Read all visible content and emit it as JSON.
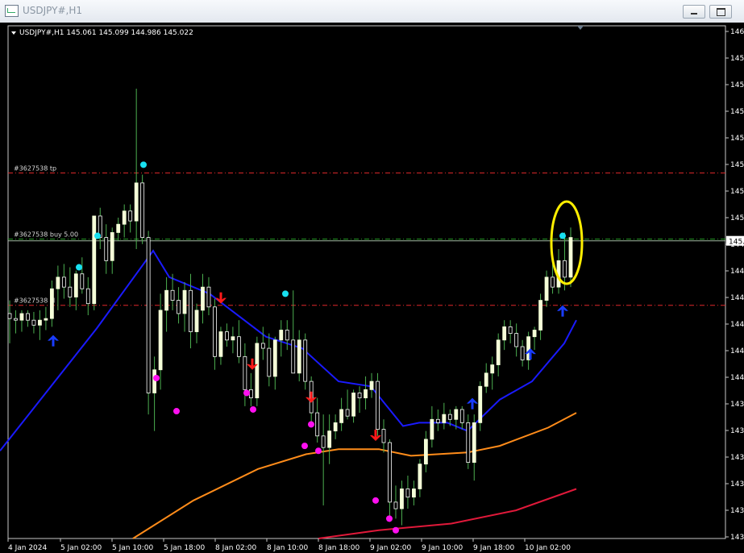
{
  "window": {
    "title": "USDJPY#,H1"
  },
  "chart_header": "USDJPY#,H1  145.061 145.099 144.986 145.022",
  "order_lines": [
    {
      "label": "#3627538 tp",
      "price": 145.41,
      "style": "dash-dot",
      "color": "#e0292b"
    },
    {
      "label": "#3627538 buy 5.00",
      "price": 145.01,
      "style": "dash-dot",
      "color": "#2a9d2a"
    },
    {
      "label": "#3627538 sl",
      "price": 144.61,
      "style": "dash-dot",
      "color": "#e0292b"
    }
  ],
  "bid_price_label": "145.0",
  "price_axis_labels": [
    "146.",
    "145.",
    "145.",
    "145.",
    "145.",
    "145.",
    "145.",
    "145.",
    "144.",
    "144.",
    "144.",
    "144.",
    "144.",
    "144.",
    "143.",
    "143.",
    "143.",
    "143.",
    "143.",
    "143."
  ],
  "time_axis_labels": [
    "4 Jan 2024",
    "5 Jan 02:00",
    "5 Jan 10:00",
    "5 Jan 18:00",
    "8 Jan 02:00",
    "8 Jan 10:00",
    "8 Jan 18:00",
    "9 Jan 02:00",
    "9 Jan 10:00",
    "9 Jan 18:00",
    "10 Jan 02:00"
  ],
  "colors": {
    "bg": "#000000",
    "candle_up": "#f5ffd8",
    "candle_down": "#ffffff",
    "wick": "#4caf50",
    "ma_fast": "#1a1aff",
    "ma_mid": "#ff8c1a",
    "ma_slow": "#e0193a",
    "dot_cyan": "#18e0f0",
    "dot_magenta": "#ff10f0",
    "arrow_up": "#1a3cff",
    "arrow_down": "#ff1a1a",
    "highlight": "#ffee00"
  },
  "chart_data": {
    "type": "candlestick",
    "symbol": "USDJPY#",
    "timeframe": "H1",
    "ylim": [
      143.2,
      146.3
    ],
    "candles": [
      [
        144.56,
        144.64,
        144.38,
        144.53
      ],
      [
        144.53,
        144.58,
        144.44,
        144.52
      ],
      [
        144.52,
        144.58,
        144.45,
        144.56
      ],
      [
        144.56,
        144.58,
        144.48,
        144.52
      ],
      [
        144.52,
        144.57,
        144.44,
        144.49
      ],
      [
        144.49,
        144.58,
        144.4,
        144.52
      ],
      [
        144.52,
        144.6,
        144.46,
        144.53
      ],
      [
        144.53,
        144.76,
        144.48,
        144.71
      ],
      [
        144.71,
        144.85,
        144.58,
        144.78
      ],
      [
        144.78,
        144.86,
        144.65,
        144.72
      ],
      [
        144.72,
        144.84,
        144.6,
        144.66
      ],
      [
        144.66,
        144.82,
        144.58,
        144.8
      ],
      [
        144.8,
        144.9,
        144.68,
        144.71
      ],
      [
        144.71,
        144.78,
        144.55,
        144.62
      ],
      [
        144.62,
        145.1,
        144.58,
        145.15
      ],
      [
        145.15,
        145.2,
        144.95,
        145.02
      ],
      [
        145.02,
        145.1,
        144.8,
        144.88
      ],
      [
        144.88,
        145.08,
        144.8,
        145.05
      ],
      [
        145.05,
        145.14,
        145.0,
        145.1
      ],
      [
        145.1,
        145.22,
        145.02,
        145.18
      ],
      [
        145.18,
        145.22,
        145.05,
        145.12
      ],
      [
        145.12,
        145.92,
        144.95,
        145.35
      ],
      [
        145.35,
        145.4,
        144.98,
        145.02
      ],
      [
        145.02,
        145.06,
        143.95,
        144.08
      ],
      [
        144.08,
        144.3,
        143.85,
        144.22
      ],
      [
        144.22,
        144.68,
        144.1,
        144.58
      ],
      [
        144.58,
        144.78,
        144.45,
        144.7
      ],
      [
        144.7,
        144.8,
        144.58,
        144.64
      ],
      [
        144.64,
        144.72,
        144.5,
        144.56
      ],
      [
        144.56,
        144.75,
        144.45,
        144.7
      ],
      [
        144.7,
        144.8,
        144.35,
        144.45
      ],
      [
        144.45,
        144.62,
        144.38,
        144.58
      ],
      [
        144.58,
        144.8,
        144.5,
        144.72
      ],
      [
        144.72,
        144.78,
        144.55,
        144.6
      ],
      [
        144.6,
        144.65,
        144.22,
        144.3
      ],
      [
        144.3,
        144.48,
        144.25,
        144.45
      ],
      [
        144.45,
        144.5,
        144.36,
        144.4
      ],
      [
        144.4,
        144.48,
        144.32,
        144.42
      ],
      [
        144.42,
        144.52,
        144.26,
        144.3
      ],
      [
        144.3,
        144.38,
        144.0,
        144.1
      ],
      [
        144.1,
        144.2,
        144.0,
        144.05
      ],
      [
        144.05,
        144.42,
        144.0,
        144.38
      ],
      [
        144.38,
        144.48,
        144.28,
        144.35
      ],
      [
        144.35,
        144.44,
        144.12,
        144.18
      ],
      [
        144.18,
        144.42,
        144.1,
        144.4
      ],
      [
        144.4,
        144.52,
        144.3,
        144.46
      ],
      [
        144.46,
        144.52,
        144.34,
        144.4
      ],
      [
        144.4,
        144.7,
        144.35,
        144.2
      ],
      [
        144.2,
        144.46,
        144.15,
        144.4
      ],
      [
        144.4,
        144.44,
        144.1,
        144.15
      ],
      [
        144.15,
        144.18,
        143.9,
        143.96
      ],
      [
        143.96,
        144.05,
        143.78,
        143.82
      ],
      [
        143.82,
        143.95,
        143.4,
        143.75
      ],
      [
        143.75,
        143.95,
        143.65,
        143.85
      ],
      [
        143.85,
        143.95,
        143.8,
        143.9
      ],
      [
        143.9,
        144.05,
        143.85,
        143.98
      ],
      [
        143.98,
        144.1,
        143.92,
        143.94
      ],
      [
        143.94,
        144.1,
        143.9,
        144.08
      ],
      [
        144.08,
        144.12,
        143.96,
        144.05
      ],
      [
        144.05,
        144.18,
        143.98,
        144.1
      ],
      [
        144.1,
        144.2,
        144.05,
        144.15
      ],
      [
        144.15,
        144.2,
        143.82,
        143.86
      ],
      [
        143.86,
        143.92,
        143.72,
        143.78
      ],
      [
        143.78,
        143.8,
        143.3,
        143.42
      ],
      [
        143.42,
        143.52,
        143.32,
        143.38
      ],
      [
        143.38,
        143.55,
        143.28,
        143.5
      ],
      [
        143.5,
        143.58,
        143.38,
        143.45
      ],
      [
        143.45,
        143.55,
        143.4,
        143.5
      ],
      [
        143.5,
        143.68,
        143.45,
        143.65
      ],
      [
        143.65,
        143.85,
        143.6,
        143.8
      ],
      [
        143.8,
        144.0,
        143.75,
        143.92
      ],
      [
        143.92,
        143.98,
        143.85,
        143.9
      ],
      [
        143.9,
        144.02,
        143.86,
        143.95
      ],
      [
        143.95,
        143.98,
        143.88,
        143.92
      ],
      [
        143.92,
        144.0,
        143.86,
        143.98
      ],
      [
        143.98,
        144.0,
        143.86,
        143.9
      ],
      [
        143.9,
        143.95,
        143.62,
        143.66
      ],
      [
        143.66,
        143.95,
        143.55,
        143.9
      ],
      [
        143.9,
        144.15,
        143.85,
        144.12
      ],
      [
        144.12,
        144.26,
        144.08,
        144.2
      ],
      [
        144.2,
        144.3,
        144.1,
        144.25
      ],
      [
        144.25,
        144.44,
        144.18,
        144.4
      ],
      [
        144.4,
        144.52,
        144.34,
        144.48
      ],
      [
        144.48,
        144.52,
        144.38,
        144.44
      ],
      [
        144.44,
        144.5,
        144.3,
        144.36
      ],
      [
        144.36,
        144.4,
        144.24,
        144.28
      ],
      [
        144.28,
        144.45,
        144.22,
        144.42
      ],
      [
        144.42,
        144.48,
        144.34,
        144.46
      ],
      [
        144.46,
        144.68,
        144.4,
        144.64
      ],
      [
        144.64,
        144.82,
        144.6,
        144.78
      ],
      [
        144.78,
        144.86,
        144.68,
        144.72
      ],
      [
        144.72,
        144.95,
        144.68,
        144.88
      ],
      [
        144.88,
        145.05,
        144.7,
        144.78
      ],
      [
        144.78,
        145.08,
        144.72,
        145.02
      ]
    ],
    "ma_fast": [
      [
        0,
        143.73
      ],
      [
        120,
        144.47
      ],
      [
        190,
        144.94
      ],
      [
        210,
        144.78
      ],
      [
        260,
        144.68
      ],
      [
        330,
        144.42
      ],
      [
        375,
        144.35
      ],
      [
        420,
        144.15
      ],
      [
        460,
        144.12
      ],
      [
        500,
        143.88
      ],
      [
        520,
        143.9
      ],
      [
        555,
        143.9
      ],
      [
        580,
        143.85
      ],
      [
        620,
        144.04
      ],
      [
        660,
        144.15
      ],
      [
        700,
        144.38
      ],
      [
        715,
        144.52
      ]
    ],
    "ma_mid": [
      [
        165,
        143.2
      ],
      [
        240,
        143.43
      ],
      [
        320,
        143.62
      ],
      [
        380,
        143.71
      ],
      [
        420,
        143.74
      ],
      [
        470,
        143.74
      ],
      [
        510,
        143.7
      ],
      [
        580,
        143.72
      ],
      [
        620,
        143.76
      ],
      [
        680,
        143.87
      ],
      [
        715,
        143.96
      ]
    ],
    "ma_slow": [
      [
        395,
        143.2
      ],
      [
        470,
        143.25
      ],
      [
        560,
        143.29
      ],
      [
        640,
        143.37
      ],
      [
        715,
        143.5
      ]
    ]
  }
}
